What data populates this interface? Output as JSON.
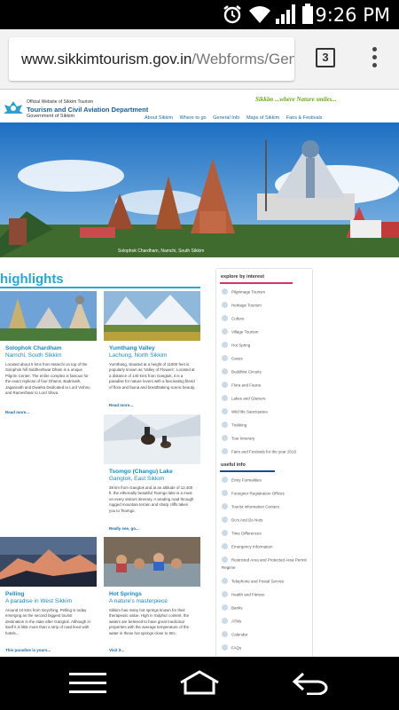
{
  "status_bar": {
    "time": "9:26 PM"
  },
  "browser": {
    "url_domain": "www.sikkimtourism.gov.in",
    "url_path": "/Webforms/Gene",
    "tab_count": "3"
  },
  "site": {
    "official": "Official Website of Sikkim Tourism",
    "dept": "Tourism and Civil Aviation Department",
    "gov": "Government of Sikkim",
    "tagline": "Sikkim ...where Nature smiles...",
    "nav": [
      "About Sikkim",
      "Where to go",
      "General Info",
      "Maps of Sikkim",
      "Fairs & Festivals"
    ]
  },
  "banner": {
    "caption": "Solophok Chardham, Namchi, South Sikkim"
  },
  "highlights": {
    "title": "highlights",
    "cards": [
      {
        "title": "Solophok Chardham",
        "sub": "Namchi, South Sikkim",
        "desc": [
          "Located about 5 kms from Namchi on top of the",
          "Solophok hill Siddheshwar Dham is a unique",
          "Pilgrim Center. The entire complex is famous for",
          "the exact replicas of four Dhams, Badrinath,",
          "Jagannath and Dwarka Dedicated to Lord Vishnu",
          "and Rameshwar to Lord Shiva."
        ],
        "more": "Read more..."
      },
      {
        "title": "Yumthang Valley",
        "sub": "Lachung, North Sikkim",
        "desc": [
          "Yumthang, situated at a height of 11800 feet is",
          "popularly known as 'Valley of Flowers'. Located at",
          "a distance of 140 kms from Gangtok, it is a",
          "paradise for nature lovers with a fascinating blend",
          "of flora and fauna and breathtaking scenic beauty."
        ],
        "more": "Read more..."
      },
      {
        "title": "Tsomgo (Changu) Lake",
        "sub": "Gangtok, East Sikkim",
        "desc": [
          "38 km from Gangtok and at an altitude of 12,400",
          "ft. the ethereally beautiful Tsomgo lake is a must",
          "on every visitors itinerary. A winding road through",
          "rugged mountain terrain and sharp cliffs takes",
          "you to Tsomgo."
        ],
        "more": "Really see, go..."
      },
      {
        "title": "Pelling",
        "sub": "A paradise in West Sikkim",
        "desc": [
          "Around 10 kms from Geyzhing, Pelling is today",
          "emerging as the second biggest tourist",
          "destination in the state after Gangtok. Although in",
          "itself it is little more than a strip of road lined with",
          "hotels..."
        ],
        "more": "This paradise is yours..."
      },
      {
        "title": "Hot Springs",
        "sub": "A nature's masterpiece",
        "desc": [
          "Sikkim has many hot springs known for their",
          "therapeutic value. High in Sulphur content, the",
          "waters are believed to have great medicinal",
          "properties with the average temperature of the",
          "water in these hot springs close to 50c."
        ],
        "more": "Visit it..."
      }
    ]
  },
  "sidebar": {
    "explore_title": "explore by interest",
    "explore": [
      "Pilgrimage Tourism",
      "Heritage Tourism",
      "Culture",
      "Village Tourism",
      "Hot Spring",
      "Caves",
      "Buddhist Circuits",
      "Flora and Fauna",
      "Lakes and Glaciers",
      "Wild life Sanctuaries",
      "Trekking",
      "Tour Itinerary",
      "Fairs and Festivals for the year 2016"
    ],
    "useful_title": "useful info",
    "useful": [
      "Entry Formalities",
      "Foreigner Registration Offices",
      "Tourist Information Centers",
      "Do's And Do Nots",
      "Time Differences",
      "Emergency Information",
      "Restricted Area and Protected Area Permit",
      "Regime",
      "Telephone and Postal Service",
      "Health and Fitness",
      "Banks",
      "ATMs",
      "Calendar",
      "FAQs"
    ]
  },
  "colors": {
    "accent": "#25a8d8",
    "explore_line": "#d6336c",
    "useful_line": "#1a4d8f",
    "nav_bar": "#000000"
  }
}
